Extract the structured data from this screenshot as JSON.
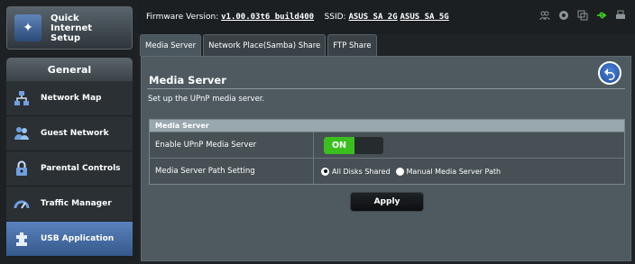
{
  "sidebar": {
    "quick_setup_label": "Quick Internet Setup",
    "section_title": "General",
    "items": [
      {
        "label": "Network Map",
        "icon": "network-map-icon",
        "active": false
      },
      {
        "label": "Guest Network",
        "icon": "guest-network-icon",
        "active": false
      },
      {
        "label": "Parental Controls",
        "icon": "parental-controls-icon",
        "active": false
      },
      {
        "label": "Traffic Manager",
        "icon": "traffic-manager-icon",
        "active": false
      },
      {
        "label": "USB Application",
        "icon": "usb-application-icon",
        "active": true
      }
    ]
  },
  "topbar": {
    "firmware_label": "Firmware Version:",
    "firmware_value": "v1.00.03t6_build400",
    "ssid_label": "SSID:",
    "ssid_2g": "ASUS_SA_2G",
    "ssid_5g": "ASUS_SA_5G",
    "status_icons": [
      "users-icon",
      "globe-icon",
      "copy-icon",
      "usb-icon",
      "printer-icon"
    ]
  },
  "tabs": [
    {
      "label": "Media Server",
      "active": true
    },
    {
      "label": "Network Place(Samba) Share",
      "active": false
    },
    {
      "label": "FTP Share",
      "active": false
    }
  ],
  "main": {
    "title": "Media Server",
    "description": "Set up the UPnP media server.",
    "table_header": "Media Server",
    "enable_label": "Enable UPnP Media Server",
    "enable_state": "ON",
    "path_label": "Media Server Path Setting",
    "path_option_all": "All Disks Shared",
    "path_option_manual": "Manual Media Server Path",
    "apply_label": "Apply"
  },
  "colors": {
    "accent_blue": "#4a76b4",
    "toggle_on": "#3bbf1e",
    "usb_green": "#3cd21f"
  }
}
